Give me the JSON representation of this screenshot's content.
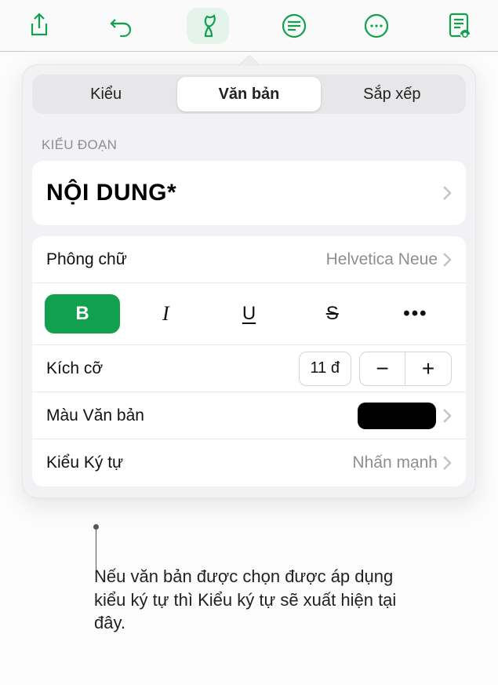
{
  "seg": {
    "style": "Kiểu",
    "text": "Văn bản",
    "arrange": "Sắp xếp"
  },
  "section": {
    "paragraph_style": "KIỂU ĐOẠN"
  },
  "para_style": {
    "name": "NỘI DUNG*"
  },
  "font_row": {
    "label": "Phông chữ",
    "value": "Helvetica Neue"
  },
  "fmt": {
    "bold": "B",
    "italic": "I",
    "underline": "U",
    "strike": "S",
    "more": "•••"
  },
  "size_row": {
    "label": "Kích cỡ",
    "value": "11 đ"
  },
  "color_row": {
    "label": "Màu Văn bản"
  },
  "charstyle_row": {
    "label": "Kiểu Ký tự",
    "value": "Nhấn mạnh"
  },
  "callout": {
    "text": "Nếu văn bản được chọn được áp dụng kiểu ký tự thì Kiểu ký tự sẽ xuất hiện tại đây."
  }
}
